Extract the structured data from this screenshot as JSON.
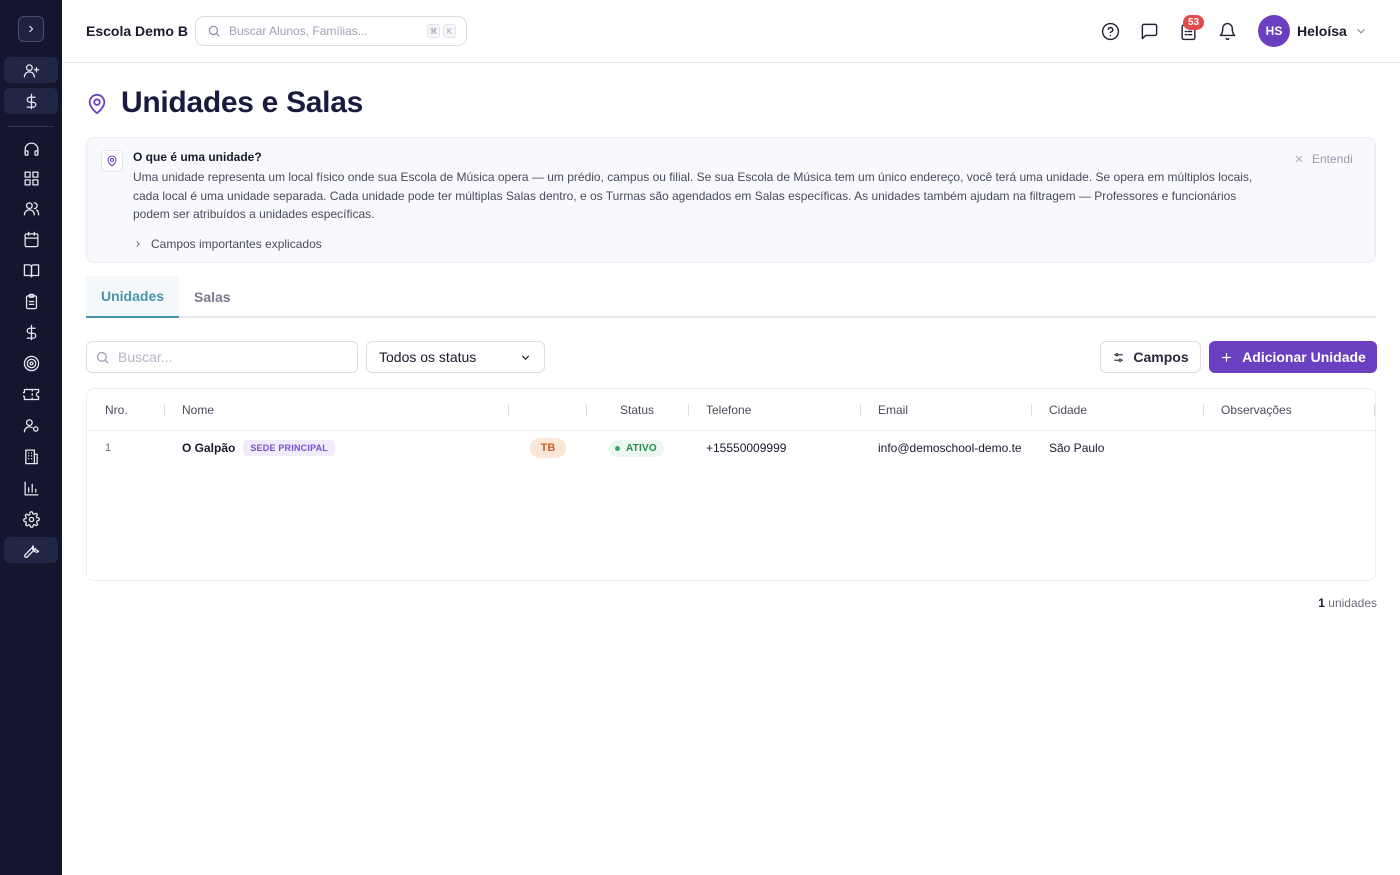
{
  "header": {
    "school_name": "Escola Demo B",
    "search_placeholder": "Buscar Alunos, Famílias...",
    "shortcut_key1": "⌘",
    "shortcut_key2": "K",
    "notification_count": "53",
    "user_initials": "HS",
    "user_name": "Heloísa"
  },
  "page": {
    "title": "Unidades e Salas"
  },
  "info_box": {
    "title": "O que é uma unidade?",
    "text": "Uma unidade representa um local físico onde sua Escola de Música opera — um prédio, campus ou filial. Se sua Escola de Música tem um único endereço, você terá uma unidade. Se opera em múltiplos locais, cada local é uma unidade separada. Cada unidade pode ter múltiplas Salas dentro, e os Turmas são agendados em Salas específicas. As unidades também ajudam na filtragem — Professores e funcionários podem ser atribuídos a unidades específicas.",
    "expander_label": "Campos importantes explicados",
    "dismiss_label": "Entendi"
  },
  "tabs": [
    {
      "label": "Unidades",
      "active": true
    },
    {
      "label": "Salas",
      "active": false
    }
  ],
  "toolbar": {
    "search_placeholder": "Buscar...",
    "status_filter_value": "Todos os status",
    "campos_label": "Campos",
    "add_label": "Adicionar Unidade"
  },
  "table": {
    "columns": [
      "Nro.",
      "Nome",
      "",
      "Status",
      "Telefone",
      "Email",
      "Cidade",
      "Observações"
    ],
    "rows": [
      {
        "nro": "1",
        "name": "O Galpão",
        "badge": "SEDE PRINCIPAL",
        "code": "TB",
        "status": "ATIVO",
        "phone": "+15550009999",
        "email": "info@demoschool-demo.te",
        "city": "São Paulo",
        "notes": ""
      }
    ]
  },
  "footer": {
    "count": "1",
    "count_label": "unidades"
  },
  "colors": {
    "sidebar_bg": "#13162e",
    "accent_purple": "#6a3fc0",
    "tab_active": "#4a95a8",
    "status_green": "#2b8a4e",
    "badge_red": "#e04a4a"
  },
  "sidebar": {
    "icons": [
      "chevron-right-icon",
      "user-plus-icon",
      "dollar-icon",
      "headset-icon",
      "grid-icon",
      "users-icon",
      "calendar-icon",
      "book-open-icon",
      "clipboard-icon",
      "dollar-icon",
      "target-icon",
      "ticket-icon",
      "user-settings-icon",
      "building-icon",
      "bar-chart-icon",
      "gear-icon",
      "wrench-icon"
    ]
  }
}
